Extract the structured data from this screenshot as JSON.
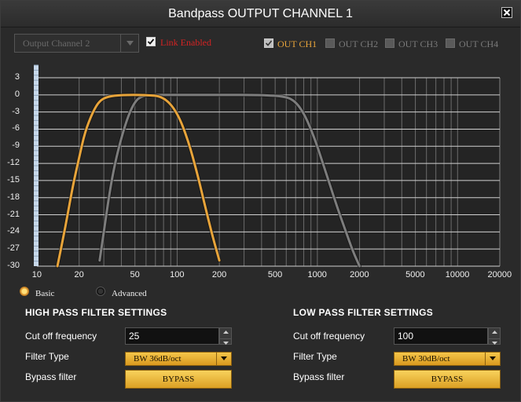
{
  "window": {
    "title": "Bandpass OUTPUT CHANNEL 1"
  },
  "channel_select": {
    "value": "Output Channel 2"
  },
  "link": {
    "label": "Link Enabled",
    "checked": true
  },
  "outputs": [
    {
      "label": "OUT CH1",
      "checked": true
    },
    {
      "label": "OUT CH2",
      "checked": false
    },
    {
      "label": "OUT CH3",
      "checked": false
    },
    {
      "label": "OUT CH4",
      "checked": false
    }
  ],
  "mode": {
    "basic_label": "Basic",
    "advanced_label": "Advanced",
    "selected": "Basic"
  },
  "colors": {
    "accent": "#e8a43a",
    "link_red": "#d42323",
    "curve_gray": "#7d7d7d",
    "grid": "#c8c8c8"
  },
  "chart_data": {
    "type": "line",
    "x_scale": "log",
    "xlim": [
      10,
      20000
    ],
    "ylim": [
      -30,
      3
    ],
    "x_ticks": [
      10,
      20,
      50,
      100,
      200,
      500,
      1000,
      2000,
      5000,
      10000,
      20000
    ],
    "x_tick_labels": [
      "10",
      "20",
      "50",
      "100",
      "200",
      "500",
      "1000",
      "2000",
      "5000",
      "10000",
      "20000"
    ],
    "y_ticks": [
      3,
      0,
      -3,
      -6,
      -9,
      -12,
      -15,
      -18,
      -21,
      -24,
      -27,
      -30
    ],
    "y_tick_labels": [
      "3",
      "0",
      "-3",
      "-6",
      "-9",
      "-12",
      "-15",
      "-18",
      "-21",
      "-24",
      "-27",
      "-30"
    ],
    "grid": true,
    "series": [
      {
        "color": "#e8a43a",
        "x": [
          14,
          16,
          18,
          20,
          22,
          25,
          28,
          32,
          40,
          60,
          80,
          100,
          120,
          140,
          160,
          180,
          200
        ],
        "y": [
          -30,
          -23,
          -16,
          -11,
          -6.5,
          -3,
          -1,
          -0.3,
          0,
          0,
          -0.3,
          -3,
          -8,
          -14,
          -20,
          -25,
          -29
        ]
      },
      {
        "color": "#7d7d7d",
        "x": [
          28,
          30,
          33,
          36,
          40,
          45,
          50,
          55,
          65,
          80,
          200,
          400,
          600,
          700,
          800,
          900,
          1000,
          1200,
          1400,
          1600,
          1800,
          2000
        ],
        "y": [
          -29,
          -24,
          -17,
          -12,
          -7.5,
          -3.5,
          -1.2,
          -0.3,
          0,
          0,
          0,
          0,
          -0.3,
          -1.2,
          -3.2,
          -6,
          -9,
          -15,
          -20,
          -24,
          -27.5,
          -30
        ]
      }
    ]
  },
  "high_pass": {
    "title": "HIGH PASS FILTER SETTINGS",
    "cutoff_label": "Cut off frequency",
    "cutoff_value": "25",
    "filter_type_label": "Filter Type",
    "filter_type_value": "BW 36dB/oct",
    "bypass_label": "Bypass filter",
    "bypass_button": "BYPASS"
  },
  "low_pass": {
    "title": "LOW PASS FILTER SETTINGS",
    "cutoff_label": "Cut off frequency",
    "cutoff_value": "100",
    "filter_type_label": "Filter Type",
    "filter_type_value": "BW 30dB/oct",
    "bypass_label": "Bypass filter",
    "bypass_button": "BYPASS"
  }
}
